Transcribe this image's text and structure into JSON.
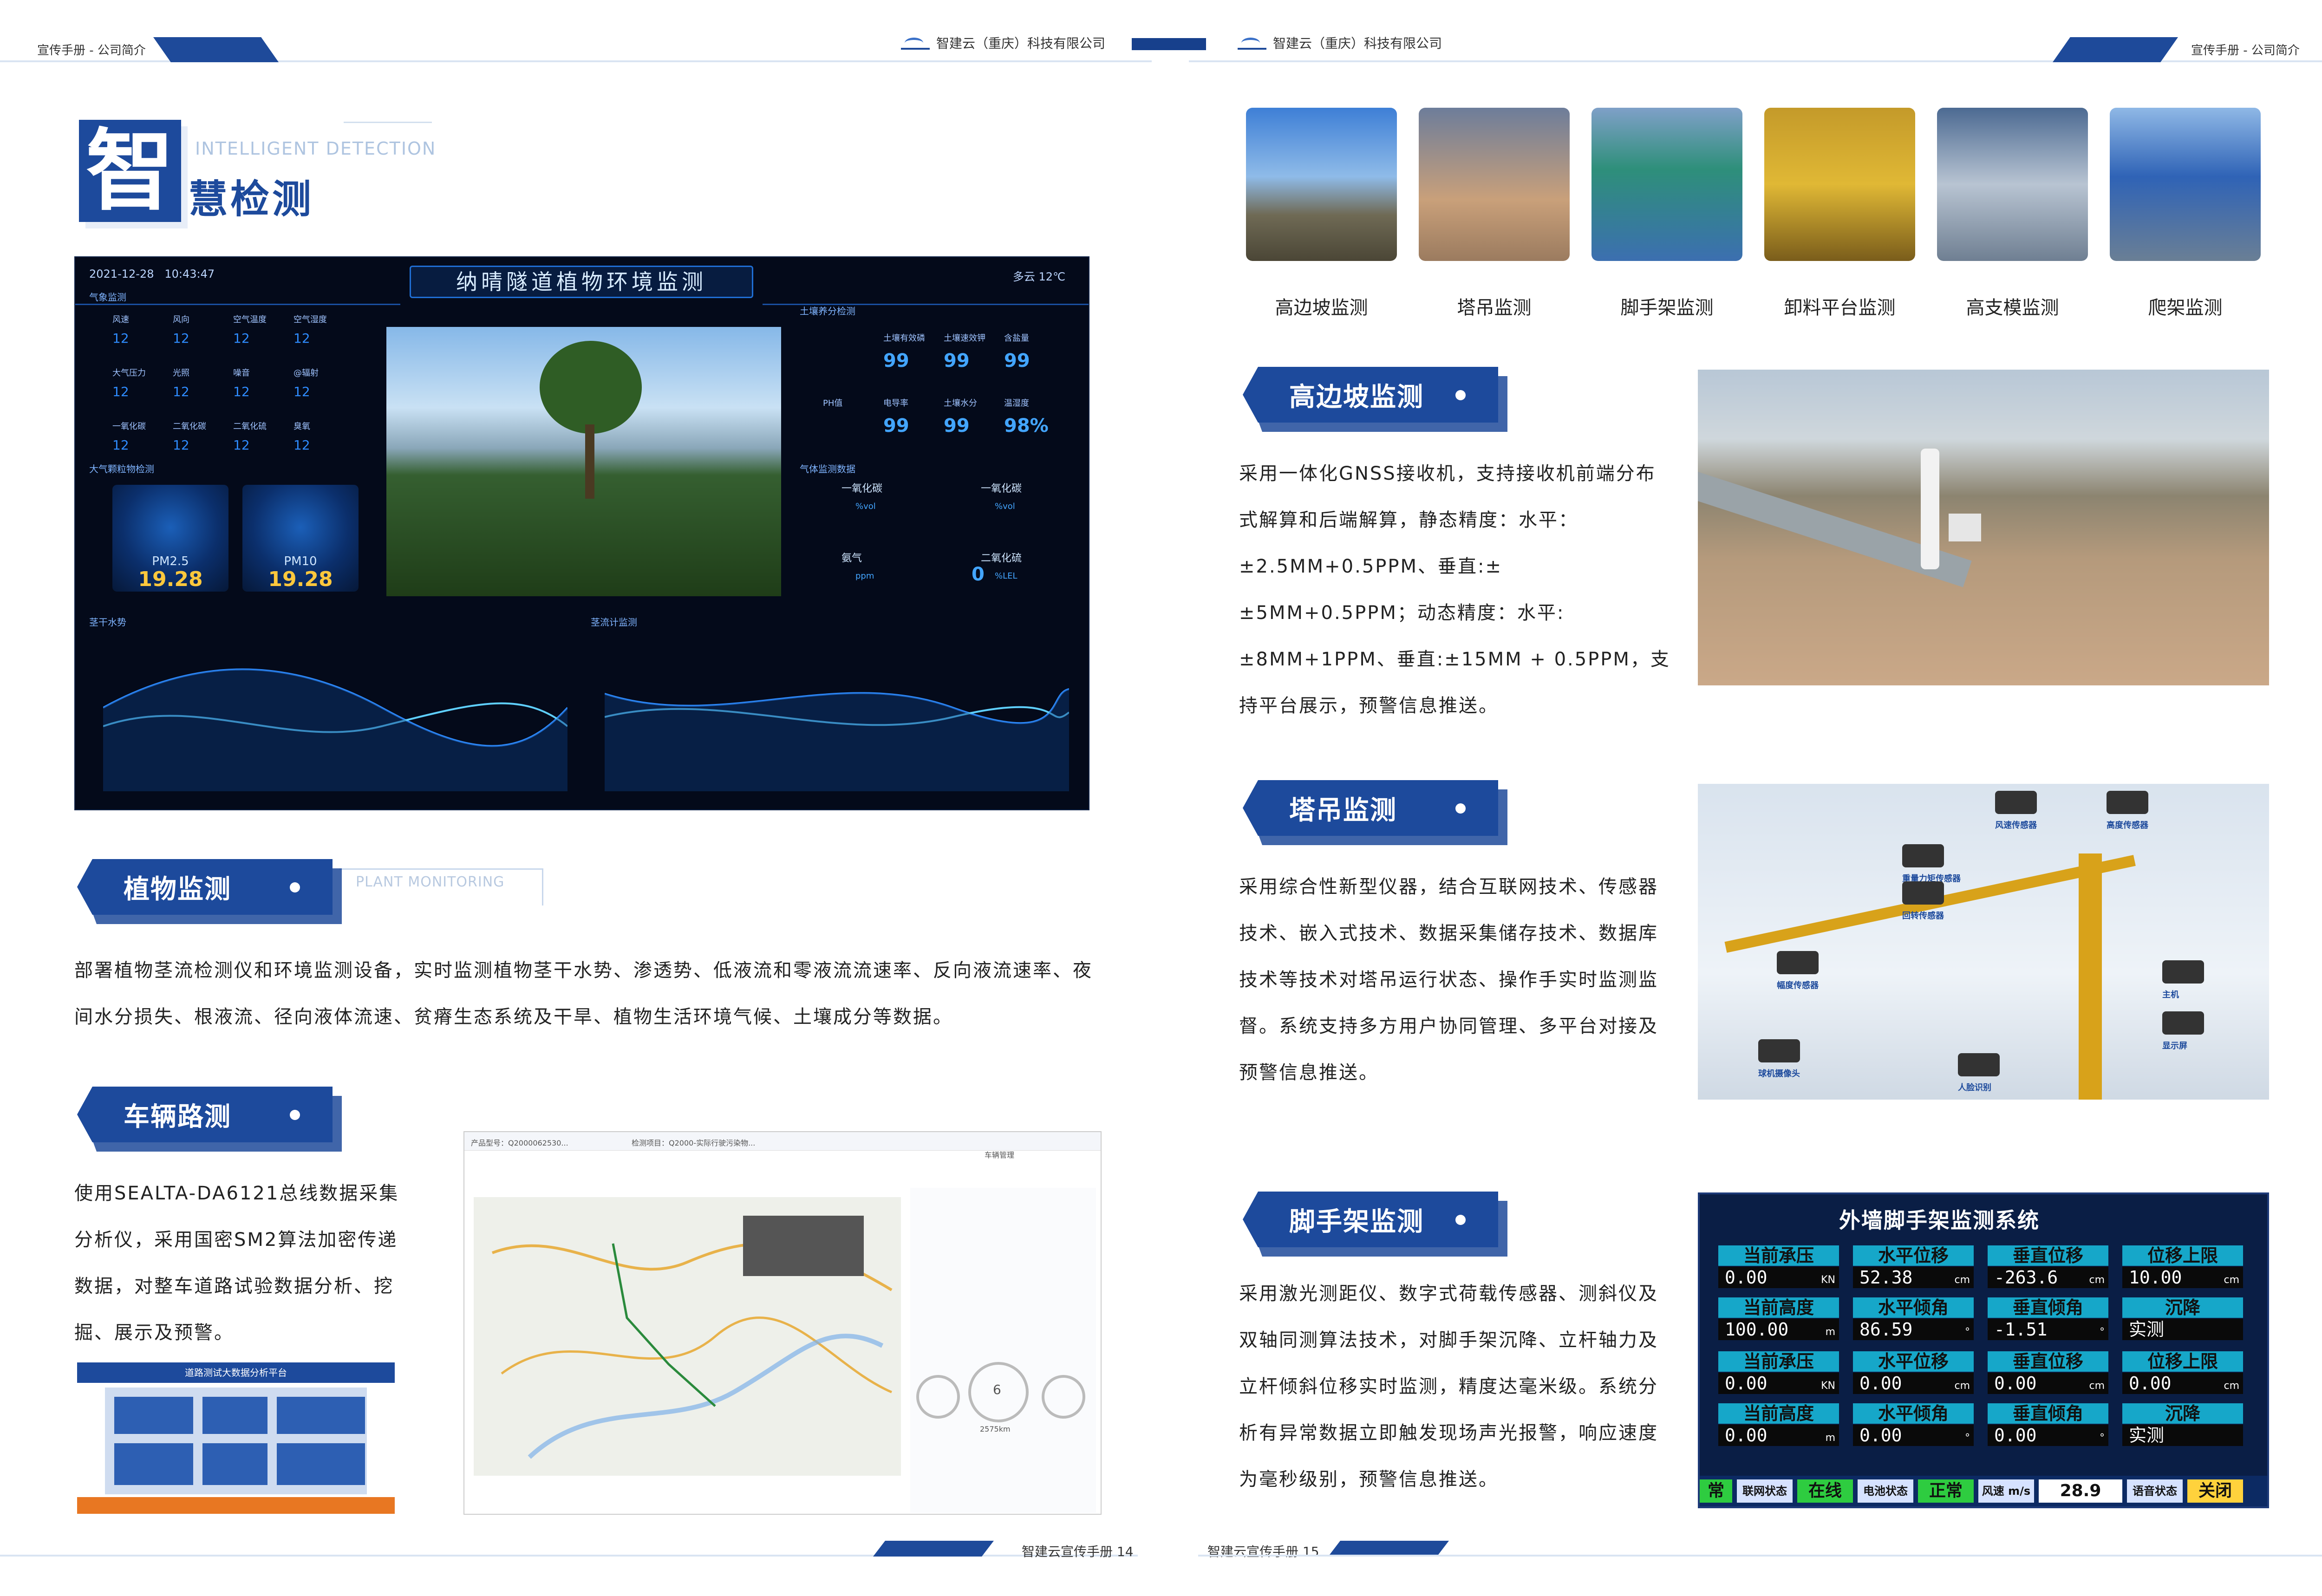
{
  "header": {
    "left_text": "宣传手册 - 公司简介",
    "right_text": "宣传手册 - 公司简介",
    "company_left": "智建云（重庆）科技有限公司",
    "company_right": "智建云（重庆）科技有限公司"
  },
  "footer": {
    "left_page": "智建云宣传手册 14",
    "right_page": "智建云宣传手册 15"
  },
  "title": {
    "big_char": "智",
    "rest": "慧检测",
    "english": "INTELLIGENT DETECTION"
  },
  "dashboard": {
    "date": "2021-12-28",
    "time": "10:43:47",
    "title": "纳晴隧道植物环境监测",
    "weather": "多云 12℃",
    "weather_section": "气象监测",
    "weather_labels": [
      "风速",
      "风向",
      "空气温度",
      "空气湿度",
      "大气压力",
      "光照",
      "噪音",
      "@辐射",
      "一氧化碳",
      "二氧化碳",
      "二氧化硫",
      "臭氧"
    ],
    "weather_value": "12",
    "soil_section": "土壤养分检测",
    "soil_labels": [
      "土壤有效磷",
      "土壤速效钾",
      "含盐量",
      "PH值",
      "电导率",
      "土壤水分",
      "温湿度"
    ],
    "soil_values": [
      "99",
      "99",
      "99",
      "99",
      "99",
      "98%"
    ],
    "particle_section": "大气颗粒物检测",
    "pm25_label": "PM2.5",
    "pm25_value": "19.28",
    "pm10_label": "PM10",
    "pm10_value": "19.28",
    "gas_section": "气体监测数据",
    "gas_labels": [
      "一氧化碳",
      "一氧化碳",
      "氨气",
      "二氧化硫"
    ],
    "gas_units": [
      "%vol",
      "%vol",
      "ppm",
      "%LEL"
    ],
    "gas_zero": "0",
    "stem_section": "茎干水势",
    "flow_section": "茎流计监测"
  },
  "plant": {
    "heading": "植物监测",
    "english": "PLANT MONITORING",
    "body": "部署植物茎流检测仪和环境监测设备，实时监测植物茎干水势、渗透势、低液流和零液流流速率、反向液流速率、夜间水分损失、根液流、径向液体流速、贫瘠生态系统及干旱、植物生活环境气候、土壤成分等数据。"
  },
  "vehicle": {
    "heading": "车辆路测",
    "body": "使用SEALTA-DA6121总线数据采集分析仪，采用国密SM2算法加密传递数据，对整车道路试验数据分析、挖掘、展示及预警。",
    "map_header_left": "产品型号：Q2000062530...",
    "map_header_mid": "检测项目：Q2000-实际行驶污染物...",
    "map_tab": "车辆管理",
    "map_gauge_speed": "2575km",
    "map_gauge_value": "6",
    "arch_title": "道路测试大数据分析平台"
  },
  "thumbs": [
    {
      "label": "高边坡监测"
    },
    {
      "label": "塔吊监测"
    },
    {
      "label": "脚手架监测"
    },
    {
      "label": "卸料平台监测"
    },
    {
      "label": "高支模监测"
    },
    {
      "label": "爬架监测"
    }
  ],
  "slope": {
    "heading": "高边坡监测",
    "body": "采用一体化GNSS接收机，支持接收机前端分布式解算和后端解算，静态精度：水平：±2.5MM+0.5PPM、垂直:±±5MM+0.5PPM；动态精度：水平:±8MM+1PPM、垂直:±15MM + 0.5PPM，支持平台展示，预警信息推送。"
  },
  "crane": {
    "heading": "塔吊监测",
    "body": "采用综合性新型仪器，结合互联网技术、传感器技术、嵌入式技术、数据采集储存技术、数据库技术等技术对塔吊运行状态、操作手实时监测监督。系统支持多方用户协同管理、多平台对接及预警信息推送。",
    "callouts": [
      "风速传感器",
      "高度传感器",
      "重量力矩传感器",
      "回转传感器",
      "幅度传感器",
      "主机",
      "显示屏",
      "球机摄像头",
      "人脸识别"
    ]
  },
  "scaffold": {
    "heading": "脚手架监测",
    "body": "采用激光测距仪、数字式荷载传感器、测斜仪及双轴同测算法技术，对脚手架沉降、立杆轴力及立杆倾斜位移实时监测，精度达毫米级。系统分析有异常数据立即触发现场声光报警，响应速度为毫秒级别，预警信息推送。",
    "screen_title": "外墙脚手架监测系统",
    "cells_row1": [
      {
        "h": "当前承压",
        "v": "0.00",
        "u": "KN"
      },
      {
        "h": "水平位移",
        "v": "52.38",
        "u": "cm"
      },
      {
        "h": "垂直位移",
        "v": "-263.6",
        "u": "cm"
      },
      {
        "h": "位移上限",
        "v": "10.00",
        "u": "cm"
      }
    ],
    "cells_row2": [
      {
        "h": "当前高度",
        "v": "100.00",
        "u": "m"
      },
      {
        "h": "水平倾角",
        "v": "86.59",
        "u": "°"
      },
      {
        "h": "垂直倾角",
        "v": "-1.51",
        "u": "°"
      },
      {
        "h": "沉降",
        "v": "实测",
        "u": ""
      }
    ],
    "cells_row3": [
      {
        "h": "当前承压",
        "v": "0.00",
        "u": "KN"
      },
      {
        "h": "水平位移",
        "v": "0.00",
        "u": "cm"
      },
      {
        "h": "垂直位移",
        "v": "0.00",
        "u": "cm"
      },
      {
        "h": "位移上限",
        "v": "0.00",
        "u": "cm"
      }
    ],
    "cells_row4": [
      {
        "h": "当前高度",
        "v": "0.00",
        "u": "m"
      },
      {
        "h": "水平倾角",
        "v": "0.00",
        "u": "°"
      },
      {
        "h": "垂直倾角",
        "v": "0.00",
        "u": "°"
      },
      {
        "h": "沉降",
        "v": "实测",
        "u": ""
      }
    ],
    "status_items": [
      "常",
      "联网状态",
      "在线",
      "电池状态",
      "正常",
      "风速 m/s",
      "28.9",
      "语音状态",
      "关闭"
    ]
  }
}
